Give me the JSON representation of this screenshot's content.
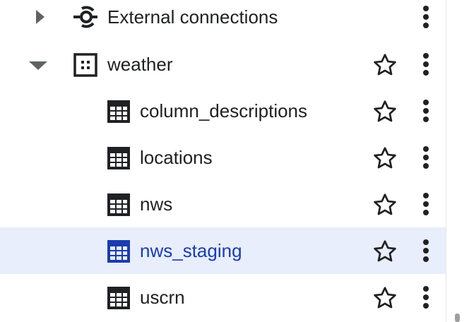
{
  "tree": {
    "connections": {
      "label": "External connections",
      "icon": "connection-icon",
      "expanded": false
    },
    "dataset": {
      "label": "weather",
      "icon": "dataset-icon",
      "expanded": true,
      "starred": false
    },
    "tables": [
      {
        "label": "column_descriptions",
        "icon": "table-icon",
        "selected": false,
        "starred": false
      },
      {
        "label": "locations",
        "icon": "table-icon",
        "selected": false,
        "starred": false
      },
      {
        "label": "nws",
        "icon": "table-icon",
        "selected": false,
        "starred": false
      },
      {
        "label": "nws_staging",
        "icon": "table-icon",
        "selected": true,
        "starred": false
      },
      {
        "label": "uscrn",
        "icon": "table-icon",
        "selected": false,
        "starred": false
      }
    ]
  },
  "colors": {
    "text": "#202124",
    "selected_text": "#1a3cb0",
    "selected_bg": "#e8eefb",
    "caret": "#5f6368"
  }
}
